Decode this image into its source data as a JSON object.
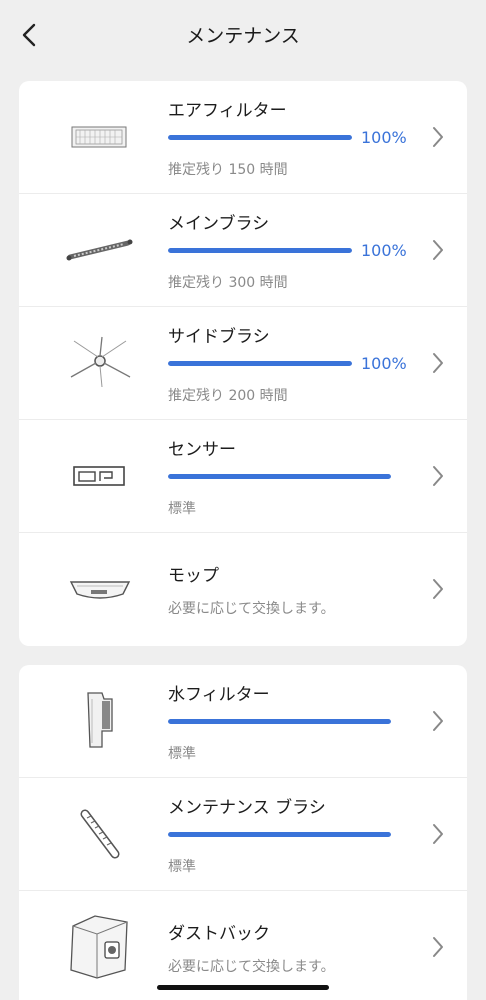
{
  "header": {
    "title": "メンテナンス"
  },
  "group1": [
    {
      "name": "エアフィルター",
      "progress": 100,
      "percent_label": "100%",
      "sub": "推定残り 150 時間",
      "icon": "air-filter-icon"
    },
    {
      "name": "メインブラシ",
      "progress": 100,
      "percent_label": "100%",
      "sub": "推定残り 300 時間",
      "icon": "main-brush-icon"
    },
    {
      "name": "サイドブラシ",
      "progress": 100,
      "percent_label": "100%",
      "sub": "推定残り 200 時間",
      "icon": "side-brush-icon"
    },
    {
      "name": "センサー",
      "progress": 100,
      "sub": "標準",
      "icon": "sensor-icon"
    },
    {
      "name": "モップ",
      "sub": "必要に応じて交換します。",
      "icon": "mop-icon"
    }
  ],
  "group2": [
    {
      "name": "水フィルター",
      "progress": 100,
      "sub": "標準",
      "icon": "water-filter-icon"
    },
    {
      "name": "メンテナンス ブラシ",
      "progress": 100,
      "sub": "標準",
      "icon": "maintenance-brush-icon"
    },
    {
      "name": "ダストバック",
      "sub": "必要に応じて交換します。",
      "icon": "dust-bag-icon"
    }
  ],
  "colors": {
    "accent": "#3a73d9",
    "background": "#efefef"
  }
}
